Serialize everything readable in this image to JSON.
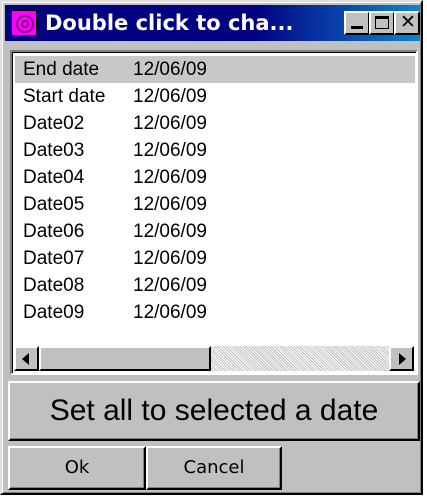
{
  "window": {
    "title": "Double click to cha...",
    "controls": {
      "minimize_icon": "minimize-icon",
      "maximize_icon": "maximize-icon",
      "close_glyph": "✕"
    }
  },
  "list": {
    "selected_index": 0,
    "rows": [
      {
        "name": "End date",
        "date": "12/06/09"
      },
      {
        "name": "Start date",
        "date": "12/06/09"
      },
      {
        "name": "Date02",
        "date": "12/06/09"
      },
      {
        "name": "Date03",
        "date": "12/06/09"
      },
      {
        "name": "Date04",
        "date": "12/06/09"
      },
      {
        "name": "Date05",
        "date": "12/06/09"
      },
      {
        "name": "Date06",
        "date": "12/06/09"
      },
      {
        "name": "Date07",
        "date": "12/06/09"
      },
      {
        "name": "Date08",
        "date": "12/06/09"
      },
      {
        "name": "Date09",
        "date": "12/06/09"
      }
    ]
  },
  "actions": {
    "set_all_label": "Set all to selected a date",
    "ok_label": "Ok",
    "cancel_label": "Cancel"
  },
  "colors": {
    "titlebar": "#000080",
    "face": "#c0c0c0",
    "selection": "#c8c8c8",
    "app_icon": "#ff00ff"
  }
}
